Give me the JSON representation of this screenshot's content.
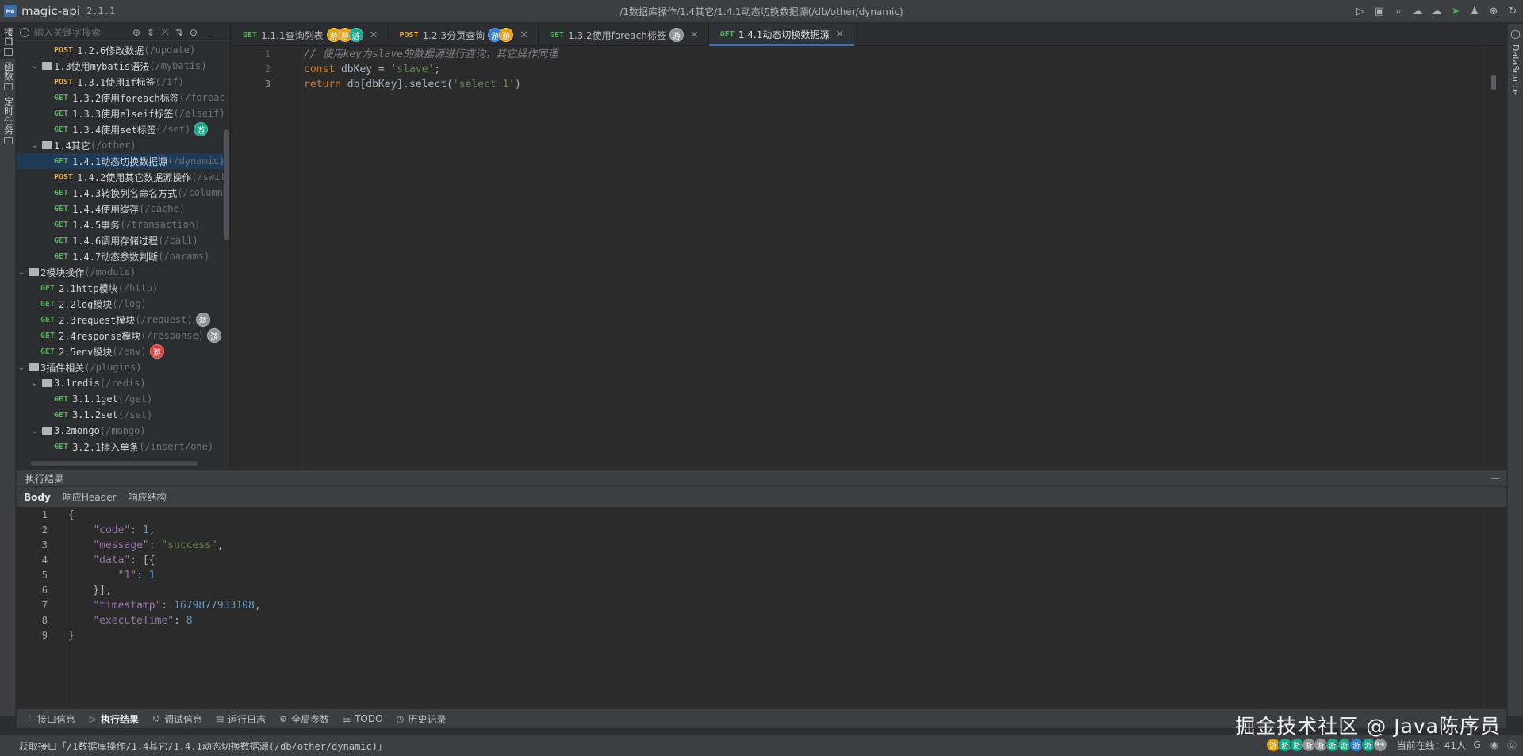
{
  "app": {
    "logo_text": "MA",
    "name": "magic-api",
    "version": "2.1.1",
    "window_path": "/1数据库操作/1.4其它/1.4.1动态切换数据源(/db/other/dynamic)"
  },
  "left_rail": [
    {
      "label": "接口",
      "icon": "api-list-icon",
      "active": true
    },
    {
      "label": "函数",
      "icon": "function-icon",
      "active": false
    },
    {
      "label": "定时任务",
      "icon": "clock-icon",
      "active": false
    }
  ],
  "right_rail": {
    "label": "DataSource",
    "icon": "database-icon"
  },
  "sidebar": {
    "search_placeholder": "输入关键字搜索",
    "tools": [
      "add-icon",
      "expand-icon",
      "collapse-icon",
      "sort-icon",
      "locate-icon",
      "minimize-icon"
    ],
    "tree": [
      {
        "indent": 2,
        "type": "api",
        "method": "POST",
        "name": "1.2.6修改数据",
        "path": "(/update)"
      },
      {
        "indent": 1,
        "type": "folder",
        "name": "1.3使用mybatis语法",
        "path": "(/mybatis)"
      },
      {
        "indent": 2,
        "type": "api",
        "method": "POST",
        "name": "1.3.1使用if标签",
        "path": "(/if)"
      },
      {
        "indent": 2,
        "type": "api",
        "method": "GET",
        "name": "1.3.2使用foreach标签",
        "path": "(/foreach"
      },
      {
        "indent": 2,
        "type": "api",
        "method": "GET",
        "name": "1.3.3使用elseif标签",
        "path": "(/elseif)"
      },
      {
        "indent": 2,
        "type": "api",
        "method": "GET",
        "name": "1.3.4使用set标签",
        "path": "(/set)",
        "badges": [
          {
            "text": "游",
            "color": "#1aa689"
          }
        ]
      },
      {
        "indent": 1,
        "type": "folder",
        "name": "1.4其它",
        "path": "(/other)"
      },
      {
        "indent": 2,
        "type": "api",
        "method": "GET",
        "name": "1.4.1动态切换数据源",
        "path": "(/dynamic)",
        "selected": true
      },
      {
        "indent": 2,
        "type": "api",
        "method": "POST",
        "name": "1.4.2使用其它数据源操作",
        "path": "(/swit"
      },
      {
        "indent": 2,
        "type": "api",
        "method": "GET",
        "name": "1.4.3转换列名命名方式",
        "path": "(/column)"
      },
      {
        "indent": 2,
        "type": "api",
        "method": "GET",
        "name": "1.4.4使用缓存",
        "path": "(/cache)"
      },
      {
        "indent": 2,
        "type": "api",
        "method": "GET",
        "name": "1.4.5事务",
        "path": "(/transaction)"
      },
      {
        "indent": 2,
        "type": "api",
        "method": "GET",
        "name": "1.4.6调用存储过程",
        "path": "(/call)"
      },
      {
        "indent": 2,
        "type": "api",
        "method": "GET",
        "name": "1.4.7动态参数判断",
        "path": "(/params)"
      },
      {
        "indent": 0,
        "type": "folder",
        "name": "2模块操作",
        "path": "(/module)"
      },
      {
        "indent": 1,
        "type": "api",
        "method": "GET",
        "name": "2.1http模块",
        "path": "(/http)"
      },
      {
        "indent": 1,
        "type": "api",
        "method": "GET",
        "name": "2.2log模块",
        "path": "(/log)"
      },
      {
        "indent": 1,
        "type": "api",
        "method": "GET",
        "name": "2.3request模块",
        "path": "(/request)",
        "badges": [
          {
            "text": "游",
            "color": "#8e9196"
          }
        ]
      },
      {
        "indent": 1,
        "type": "api",
        "method": "GET",
        "name": "2.4response模块",
        "path": "(/response)",
        "badges": [
          {
            "text": "游",
            "color": "#8e9196"
          }
        ]
      },
      {
        "indent": 1,
        "type": "api",
        "method": "GET",
        "name": "2.5env模块",
        "path": "(/env)",
        "badges": [
          {
            "text": "游",
            "color": "#d94040"
          }
        ]
      },
      {
        "indent": 0,
        "type": "folder",
        "name": "3插件相关",
        "path": "(/plugins)"
      },
      {
        "indent": 1,
        "type": "folder",
        "name": "3.1redis",
        "path": "(/redis)"
      },
      {
        "indent": 2,
        "type": "api",
        "method": "GET",
        "name": "3.1.1get",
        "path": "(/get)"
      },
      {
        "indent": 2,
        "type": "api",
        "method": "GET",
        "name": "3.1.2set",
        "path": "(/set)"
      },
      {
        "indent": 1,
        "type": "folder",
        "name": "3.2mongo",
        "path": "(/mongo)"
      },
      {
        "indent": 2,
        "type": "api",
        "method": "GET",
        "name": "3.2.1插入单条",
        "path": "(/insert/one)"
      }
    ]
  },
  "tabs": [
    {
      "method": "GET",
      "label": "1.1.1查询列表",
      "badges": [
        {
          "text": "游",
          "color": "#d9a21b"
        },
        {
          "text": "游",
          "color": "#e6a019"
        },
        {
          "text": "游",
          "color": "#1aa689"
        }
      ],
      "active": false
    },
    {
      "method": "POST",
      "label": "1.2.3分页查询",
      "badges": [
        {
          "text": "游",
          "color": "#2f7fd0"
        },
        {
          "text": "游",
          "color": "#e6a019"
        }
      ],
      "active": false
    },
    {
      "method": "GET",
      "label": "1.3.2使用foreach标签",
      "badges": [
        {
          "text": "游",
          "color": "#8e9196"
        }
      ],
      "active": false
    },
    {
      "method": "GET",
      "label": "1.4.1动态切换数据源",
      "badges": [],
      "active": true
    }
  ],
  "editor": {
    "line_numbers": [
      "1",
      "2",
      "3"
    ],
    "current_line": 3,
    "lines": [
      [
        {
          "t": "comment",
          "v": "// 使用key为slave的数据源进行查询，其它操作同理"
        }
      ],
      [
        {
          "t": "kw",
          "v": "const "
        },
        {
          "t": "plain",
          "v": "dbKey = "
        },
        {
          "t": "str",
          "v": "'slave'"
        },
        {
          "t": "plain",
          "v": ";"
        }
      ],
      [
        {
          "t": "kw",
          "v": "return "
        },
        {
          "t": "plain",
          "v": "db[dbKey].select("
        },
        {
          "t": "str",
          "v": "'select 1'"
        },
        {
          "t": "plain",
          "v": ")"
        }
      ]
    ]
  },
  "result": {
    "title": "执行结果",
    "minimize_symbol": "—",
    "tabs": [
      {
        "label": "Body",
        "active": true
      },
      {
        "label": "响应Header",
        "active": false
      },
      {
        "label": "响应结构",
        "active": false
      }
    ],
    "line_numbers": [
      "1",
      "2",
      "3",
      "4",
      "5",
      "6",
      "7",
      "8",
      "9"
    ],
    "lines": [
      [
        {
          "t": "p",
          "v": "{"
        }
      ],
      [
        {
          "t": "p",
          "v": "    "
        },
        {
          "t": "k",
          "v": "\"code\""
        },
        {
          "t": "p",
          "v": ": "
        },
        {
          "t": "n",
          "v": "1"
        },
        {
          "t": "p",
          "v": ","
        }
      ],
      [
        {
          "t": "p",
          "v": "    "
        },
        {
          "t": "k",
          "v": "\"message\""
        },
        {
          "t": "p",
          "v": ": "
        },
        {
          "t": "s",
          "v": "\"success\""
        },
        {
          "t": "p",
          "v": ","
        }
      ],
      [
        {
          "t": "p",
          "v": "    "
        },
        {
          "t": "k",
          "v": "\"data\""
        },
        {
          "t": "p",
          "v": ": [{"
        }
      ],
      [
        {
          "t": "p",
          "v": "        "
        },
        {
          "t": "k",
          "v": "\"1\""
        },
        {
          "t": "p",
          "v": ": "
        },
        {
          "t": "n",
          "v": "1"
        }
      ],
      [
        {
          "t": "p",
          "v": "    }],"
        }
      ],
      [
        {
          "t": "p",
          "v": "    "
        },
        {
          "t": "k",
          "v": "\"timestamp\""
        },
        {
          "t": "p",
          "v": ": "
        },
        {
          "t": "n",
          "v": "1679877933108"
        },
        {
          "t": "p",
          "v": ","
        }
      ],
      [
        {
          "t": "p",
          "v": "    "
        },
        {
          "t": "k",
          "v": "\"executeTime\""
        },
        {
          "t": "p",
          "v": ": "
        },
        {
          "t": "n",
          "v": "8"
        }
      ],
      [
        {
          "t": "p",
          "v": "}"
        }
      ]
    ]
  },
  "bottom_tools": [
    {
      "label": "接口信息",
      "icon": "info-icon",
      "glyph": "⫶",
      "active": false
    },
    {
      "label": "执行结果",
      "icon": "run-icon",
      "glyph": "▷",
      "active": true
    },
    {
      "label": "调试信息",
      "icon": "debug-icon",
      "glyph": "⛭",
      "active": false
    },
    {
      "label": "运行日志",
      "icon": "log-icon",
      "glyph": "▤",
      "active": false
    },
    {
      "label": "全局参数",
      "icon": "settings-icon",
      "glyph": "⚙",
      "active": false
    },
    {
      "label": "TODO",
      "icon": "todo-icon",
      "glyph": "☰",
      "active": false
    },
    {
      "label": "历史记录",
      "icon": "history-icon",
      "glyph": "◷",
      "active": false
    }
  ],
  "status": {
    "text": "获取接口「/1数据库操作/1.4其它/1.4.1动态切换数据源(/db/other/dynamic)」",
    "avatars": [
      {
        "text": "游",
        "color": "#d9a21b"
      },
      {
        "text": "游",
        "color": "#1aa689"
      },
      {
        "text": "游",
        "color": "#1aa689"
      },
      {
        "text": "游",
        "color": "#8e9196"
      },
      {
        "text": "游",
        "color": "#8e9196"
      },
      {
        "text": "游",
        "color": "#1aa689"
      },
      {
        "text": "游",
        "color": "#1aa689"
      },
      {
        "text": "游",
        "color": "#2f7fd0"
      },
      {
        "text": "游",
        "color": "#1aa689"
      },
      {
        "text": "9+",
        "color": "#8e9196"
      }
    ],
    "online_text": "当前在线：41人",
    "icons": [
      "g-icon",
      "github-icon",
      "gitee-icon"
    ]
  },
  "title_actions": [
    {
      "icon": "run-icon",
      "glyph": "▷"
    },
    {
      "icon": "save-icon",
      "glyph": "▣"
    },
    {
      "icon": "search-icon",
      "glyph": "⌕"
    },
    {
      "icon": "cloud-download-icon",
      "glyph": "☁"
    },
    {
      "icon": "cloud-upload-icon",
      "glyph": "☁"
    },
    {
      "icon": "send-icon",
      "glyph": "➤"
    },
    {
      "icon": "skin-icon",
      "glyph": "♟"
    },
    {
      "icon": "globe-icon",
      "glyph": "⊕"
    },
    {
      "icon": "refresh-icon",
      "glyph": "↻"
    }
  ],
  "watermark": "掘金技术社区 @ Java陈序员"
}
